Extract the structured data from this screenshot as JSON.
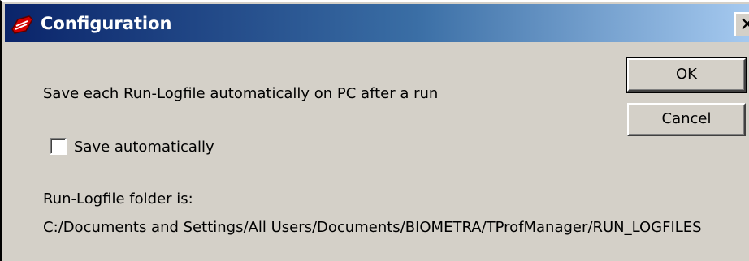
{
  "window": {
    "title": "Configuration",
    "close_glyph": "✕",
    "icon": "app-logo-icon"
  },
  "content": {
    "description": "Save each Run-Logfile automatically on PC after a run",
    "checkbox_label": "Save automatically",
    "checkbox_checked": false,
    "folder_label": "Run-Logfile folder is:",
    "folder_path": "C:/Documents and Settings/All Users/Documents/BIOMETRA/TProfManager/RUN_LOGFILES"
  },
  "buttons": {
    "ok_label": "OK",
    "cancel_label": "Cancel"
  },
  "colors": {
    "titlebar_start": "#0a246a",
    "titlebar_end": "#a6caf0",
    "face": "#d4d0c8",
    "icon_red": "#d40000"
  }
}
